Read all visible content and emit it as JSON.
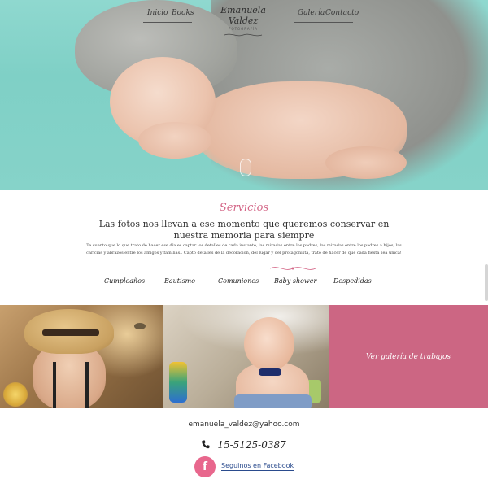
{
  "nav": {
    "items_left": [
      "Inicio",
      "Books"
    ],
    "items_right": [
      "Galería",
      "Contacto"
    ],
    "logo_name": "Emanuela Valdez",
    "logo_sub": "FOTOGRAFÍA"
  },
  "services": {
    "title": "Servicios",
    "headline": "Las fotos nos llevan a ese momento que queremos conservar en nuestra memoria para siempre",
    "body": "Te cuento que lo que trato de hacer ese día es captar los detalles de cada instante, las miradas entre los padres, las miradas entre los padres a hijos, las caricias y abrazos entre los amigos y familias.. Capto detalles de la decoración, del lugar y del protagonista, trato de hacer de que cada fiesta sea única!",
    "categories": [
      "Cumpleaños",
      "Bautismo",
      "Comuniones",
      "Baby shower",
      "Despedidas"
    ]
  },
  "gallery": {
    "cta": "Ver galería de trabajos"
  },
  "footer": {
    "email": "emanuela_valdez@yahoo.com",
    "phone": "15-5125-0387",
    "facebook": "Seguinos en Facebook"
  },
  "colors": {
    "accent": "#cc6683",
    "title_pink": "#d46788",
    "facebook_circle": "#e8678d",
    "hero_bg": "#86d3c9"
  },
  "icons": [
    "phone-icon",
    "facebook-icon",
    "flourish-divider"
  ]
}
